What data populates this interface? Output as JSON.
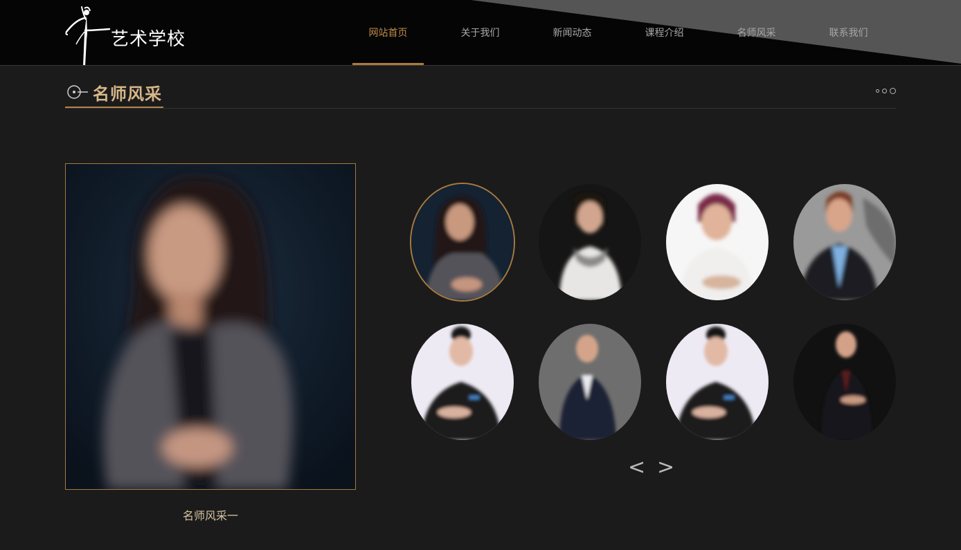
{
  "header": {
    "logo_text": "艺术学校",
    "nav": [
      {
        "label": "网站首页",
        "active": true
      },
      {
        "label": "关于我们",
        "active": false
      },
      {
        "label": "新闻动态",
        "active": false
      },
      {
        "label": "课程介绍",
        "active": false
      },
      {
        "label": "名师风采",
        "active": false
      },
      {
        "label": "联系我们",
        "active": false
      }
    ]
  },
  "section": {
    "title": "名师风采"
  },
  "featured": {
    "caption": "名师风采一"
  },
  "gallery": {
    "prev_label": "<",
    "next_label": ">",
    "selected_index": 0
  },
  "colors": {
    "accent": "#b4834b",
    "background": "#1b1b1b",
    "header_bg": "#050505",
    "title_text": "#d7b78a"
  }
}
